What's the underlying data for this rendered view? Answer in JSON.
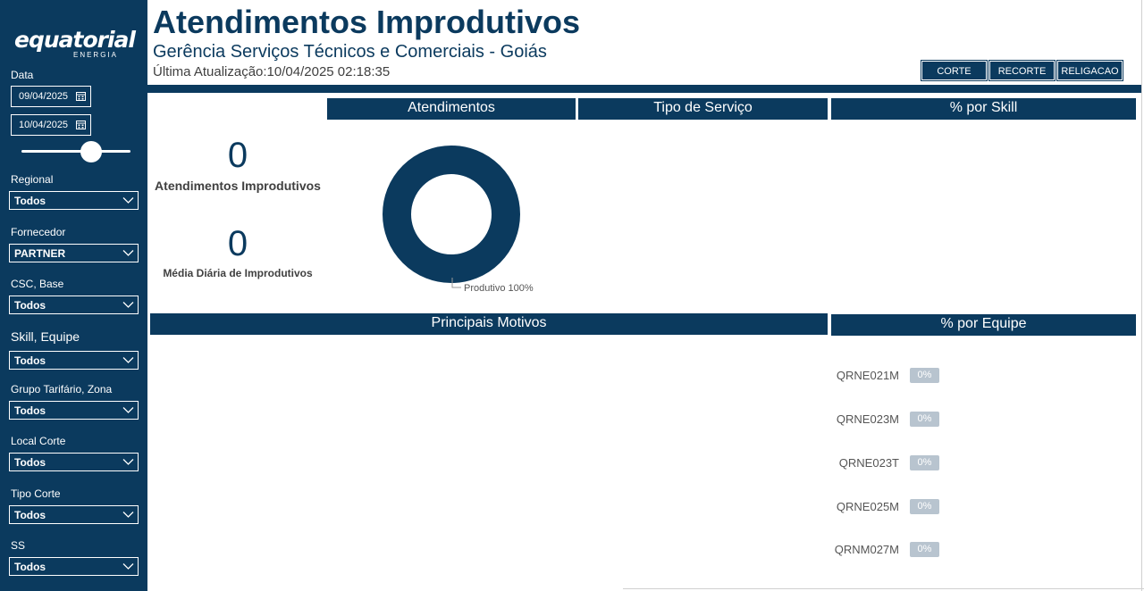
{
  "logo": {
    "main": "equatorial",
    "sub": "ENERGIA"
  },
  "filters": {
    "date_label": "Data",
    "date_start": "09/04/2025",
    "date_end": "10/04/2025",
    "regional": {
      "label": "Regional",
      "value": "Todos"
    },
    "fornecedor": {
      "label": "Fornecedor",
      "value": "PARTNER"
    },
    "csc_base": {
      "label": "CSC, Base",
      "value": "Todos"
    },
    "skill_equipe": {
      "label": "Skill, Equipe",
      "value": "Todos"
    },
    "grupo_tarifario": {
      "label": "Grupo Tarifário, Zona",
      "value": "Todos"
    },
    "local_corte": {
      "label": "Local Corte",
      "value": "Todos"
    },
    "tipo_corte": {
      "label": "Tipo Corte",
      "value": "Todos"
    },
    "ss": {
      "label": "SS",
      "value": "Todos"
    }
  },
  "header": {
    "title": "Atendimentos Improdutivos",
    "subtitle": "Gerência Serviços Técnicos e Comerciais - Goiás",
    "updated": "Última Atualização:10/04/2025 02:18:35",
    "buttons": [
      "CORTE",
      "RECORTE",
      "RELIGACAO"
    ]
  },
  "sections": {
    "atendimentos": "Atendimentos",
    "tipo_servico": "Tipo de Serviço",
    "pct_skill": "% por Skill",
    "principais_motivos": "Principais Motivos",
    "pct_equipe": "% por Equipe"
  },
  "kpis": {
    "atendimentos_value": "0",
    "atendimentos_label": "Atendimentos Improdutivos",
    "media_value": "0",
    "media_label": "Média Diária de Improdutivos"
  },
  "chart_data": {
    "type": "pie",
    "categories": [
      "Produtivo"
    ],
    "values": [
      100
    ],
    "data_labels": [
      "Produtivo 100%"
    ],
    "colors": [
      "#0b3a5e"
    ]
  },
  "equipes": [
    {
      "name": "QRNE021M",
      "pct": "0%"
    },
    {
      "name": "QRNE023M",
      "pct": "0%"
    },
    {
      "name": "QRNE023T",
      "pct": "0%"
    },
    {
      "name": "QRNE025M",
      "pct": "0%"
    },
    {
      "name": "QRNM027M",
      "pct": "0%"
    }
  ],
  "colors": {
    "brand": "#0b3a5e",
    "badge": "#b8c4cf"
  }
}
